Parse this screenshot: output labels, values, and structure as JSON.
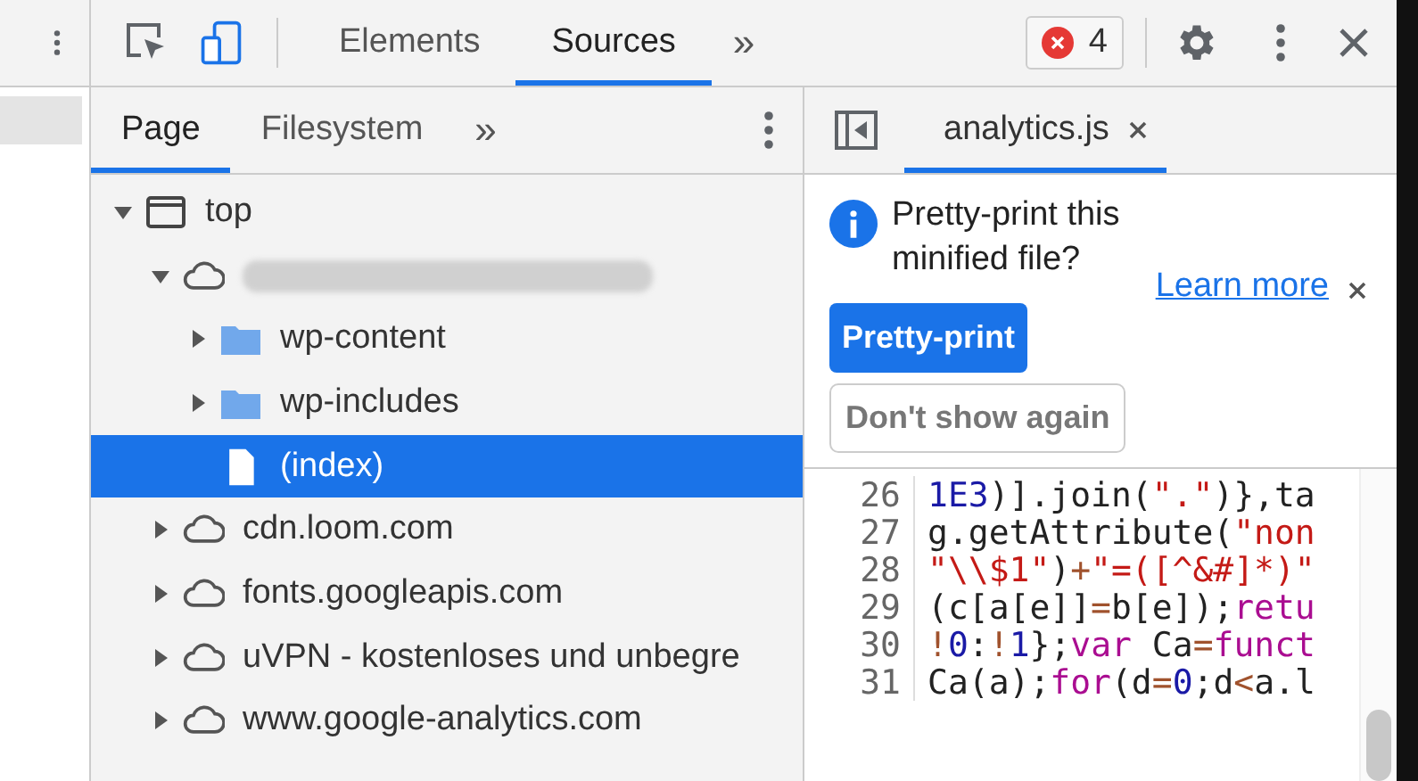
{
  "toolbar": {
    "tabs": [
      {
        "label": "Elements",
        "selected": false
      },
      {
        "label": "Sources",
        "selected": true
      }
    ],
    "more": "»",
    "error_count": "4"
  },
  "navigator": {
    "tabs": [
      {
        "label": "Page",
        "selected": true
      },
      {
        "label": "Filesystem",
        "selected": false
      }
    ],
    "more": "»",
    "tree": [
      {
        "kind": "frame",
        "label": "top",
        "expanded": true,
        "selected": false,
        "children": [
          {
            "kind": "blurred",
            "expanded": true,
            "selected": false,
            "children": [
              {
                "kind": "folder",
                "label": "wp-content",
                "expanded": false,
                "selected": false
              },
              {
                "kind": "folder",
                "label": "wp-includes",
                "expanded": false,
                "selected": false
              },
              {
                "kind": "file",
                "label": "(index)",
                "selected": true
              }
            ]
          },
          {
            "kind": "domain",
            "label": "cdn.loom.com",
            "expanded": false,
            "selected": false
          },
          {
            "kind": "domain",
            "label": "fonts.googleapis.com",
            "expanded": false,
            "selected": false
          },
          {
            "kind": "domain",
            "label": "uVPN - kostenloses und unbegre",
            "expanded": false,
            "selected": false
          },
          {
            "kind": "domain",
            "label": "www.google-analytics.com",
            "expanded": false,
            "selected": false
          }
        ]
      }
    ]
  },
  "editor": {
    "tabs": [
      {
        "label": "analytics.js",
        "selected": true
      }
    ],
    "infobar": {
      "message": "Pretty-print this minified file?",
      "link": "Learn more",
      "primary_button": "Pretty-print",
      "secondary_button": "Don't show again"
    },
    "lines": [
      {
        "number": "26",
        "tokens": [
          {
            "kind": "num",
            "text": "1E3"
          },
          {
            "kind": "plain",
            "text": ")].join("
          },
          {
            "kind": "str",
            "text": "\".\""
          },
          {
            "kind": "plain",
            "text": ")},ta"
          }
        ]
      },
      {
        "number": "27",
        "tokens": [
          {
            "kind": "plain",
            "text": "g.getAttribute("
          },
          {
            "kind": "str",
            "text": "\"non"
          }
        ]
      },
      {
        "number": "28",
        "tokens": [
          {
            "kind": "str",
            "text": "\"\\\\$1\""
          },
          {
            "kind": "plain",
            "text": ")"
          },
          {
            "kind": "op",
            "text": "+"
          },
          {
            "kind": "str",
            "text": "\"=([^&#]*)\""
          }
        ]
      },
      {
        "number": "29",
        "tokens": [
          {
            "kind": "plain",
            "text": "(c[a[e]]"
          },
          {
            "kind": "op",
            "text": "="
          },
          {
            "kind": "plain",
            "text": "b[e]);"
          },
          {
            "kind": "kw",
            "text": "retu"
          }
        ]
      },
      {
        "number": "30",
        "tokens": [
          {
            "kind": "op",
            "text": "!"
          },
          {
            "kind": "num",
            "text": "0"
          },
          {
            "kind": "plain",
            "text": ":"
          },
          {
            "kind": "op",
            "text": "!"
          },
          {
            "kind": "num",
            "text": "1"
          },
          {
            "kind": "plain",
            "text": "};"
          },
          {
            "kind": "kw",
            "text": "var"
          },
          {
            "kind": "plain",
            "text": " Ca"
          },
          {
            "kind": "op",
            "text": "="
          },
          {
            "kind": "kw",
            "text": "funct"
          }
        ]
      },
      {
        "number": "31",
        "tokens": [
          {
            "kind": "plain",
            "text": "Ca(a);"
          },
          {
            "kind": "kw",
            "text": "for"
          },
          {
            "kind": "plain",
            "text": "(d"
          },
          {
            "kind": "op",
            "text": "="
          },
          {
            "kind": "num",
            "text": "0"
          },
          {
            "kind": "plain",
            "text": ";d"
          },
          {
            "kind": "op",
            "text": "<"
          },
          {
            "kind": "plain",
            "text": "a.l"
          }
        ]
      }
    ]
  }
}
